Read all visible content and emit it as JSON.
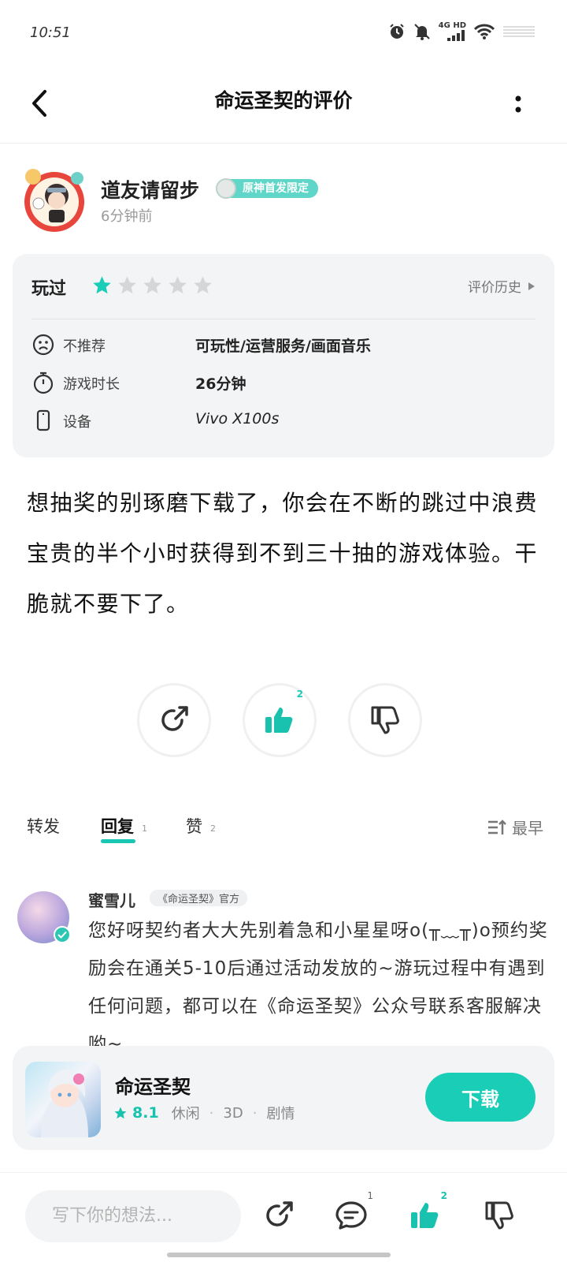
{
  "status_bar": {
    "time": "10:51",
    "network": "4G HD"
  },
  "nav": {
    "title": "命运圣契的评价"
  },
  "author": {
    "name": "道友请留步",
    "badge": "原神首发限定",
    "time": "6分钟前"
  },
  "review": {
    "played_label": "玩过",
    "rating": 1,
    "max_rating": 5,
    "history_label": "评价历史",
    "rows": [
      {
        "icon": "sad-face-icon",
        "label": "不推荐",
        "value": "可玩性/运营服务/画面音乐"
      },
      {
        "icon": "stopwatch-icon",
        "label": "游戏时长",
        "value": "26分钟"
      },
      {
        "icon": "phone-icon",
        "label": "设备",
        "value": "Vivo X100s"
      }
    ],
    "text": "想抽奖的别琢磨下载了，你会在不断的跳过中浪费宝贵的半个小时获得到不到三十抽的游戏体验。干脆就不要下了。"
  },
  "actions": {
    "like_count": "2"
  },
  "tabs": [
    {
      "label": "转发",
      "count": ""
    },
    {
      "label": "回复",
      "count": "1"
    },
    {
      "label": "赞",
      "count": "2"
    }
  ],
  "sort": {
    "label": "最早"
  },
  "reply": {
    "name": "蜜雪儿",
    "badge": "《命运圣契》官方",
    "text": "您好呀契约者大大先别着急和小星星呀o(╥﹏╥)o预约奖励会在通关5-10后通过活动发放的~游玩过程中有遇到任何问题，都可以在《命运圣契》公众号联系客服解决哟~"
  },
  "game": {
    "name": "命运圣契",
    "score": "8.1",
    "tags": [
      "休闲",
      "3D",
      "剧情"
    ],
    "download_label": "下载"
  },
  "bottom_bar": {
    "placeholder": "写下你的想法...",
    "reply_count": "1",
    "like_count": "2"
  },
  "colors": {
    "accent": "#19cdb6",
    "card_bg": "#f3f4f5"
  }
}
